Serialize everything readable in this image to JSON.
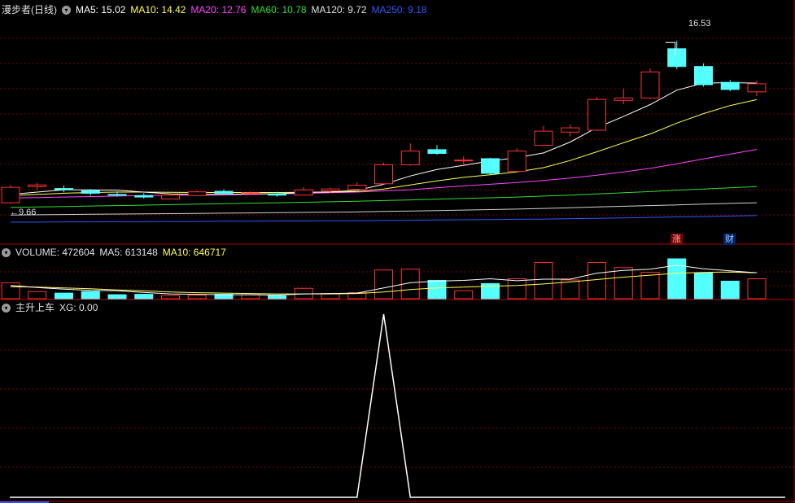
{
  "price_header": {
    "title": "漫步者(日线)",
    "ma": [
      {
        "label": "MA5: 15.02",
        "color": "#ffffff"
      },
      {
        "label": "MA10: 14.42",
        "color": "#ffff55"
      },
      {
        "label": "MA20: 12.76",
        "color": "#ff44ff"
      },
      {
        "label": "MA60: 10.78",
        "color": "#33dd33"
      },
      {
        "label": "MA120: 9.72",
        "color": "#e0e0e0"
      },
      {
        "label": "MA250: 9.18",
        "color": "#3355ff"
      }
    ]
  },
  "volume_header": {
    "items": [
      {
        "label": "VOLUME: 472604",
        "color": "#e0e0e0"
      },
      {
        "label": "MA5: 613148",
        "color": "#e0e0e0"
      },
      {
        "label": "MA10: 646717",
        "color": "#ffff55"
      }
    ]
  },
  "indicator_header": {
    "items": [
      {
        "label": "主升上车",
        "color": "#e0e0e0"
      },
      {
        "label": "XG: 0.00",
        "color": "#e0e0e0"
      }
    ]
  },
  "annotations": {
    "high_label": "16.53",
    "low_label": "←9.66",
    "badge_rise": "涨",
    "badge_finance": "财"
  },
  "colors": {
    "up": "#ff3232",
    "down": "#54ffff",
    "grid": "#7a0000",
    "border": "#b00000",
    "xg_line": "#ffffff"
  },
  "chart_data": [
    {
      "type": "candlestick",
      "title": "漫步者(日线)",
      "ylim": [
        8.5,
        17.5
      ],
      "ohlc": [
        {
          "o": 9.7,
          "h": 10.45,
          "l": 9.66,
          "c": 10.35
        },
        {
          "o": 10.38,
          "h": 10.55,
          "l": 10.25,
          "c": 10.45
        },
        {
          "o": 10.3,
          "h": 10.42,
          "l": 10.14,
          "c": 10.25
        },
        {
          "o": 10.2,
          "h": 10.28,
          "l": 10.0,
          "c": 10.1
        },
        {
          "o": 10.05,
          "h": 10.18,
          "l": 9.96,
          "c": 10.02
        },
        {
          "o": 10.0,
          "h": 10.1,
          "l": 9.88,
          "c": 9.94
        },
        {
          "o": 9.86,
          "h": 10.06,
          "l": 9.84,
          "c": 10.02
        },
        {
          "o": 10.0,
          "h": 10.22,
          "l": 9.98,
          "c": 10.16
        },
        {
          "o": 10.18,
          "h": 10.26,
          "l": 10.04,
          "c": 10.1
        },
        {
          "o": 10.1,
          "h": 10.18,
          "l": 10.02,
          "c": 10.12
        },
        {
          "o": 10.08,
          "h": 10.16,
          "l": 9.96,
          "c": 10.02
        },
        {
          "o": 10.02,
          "h": 10.36,
          "l": 10.0,
          "c": 10.24
        },
        {
          "o": 10.2,
          "h": 10.34,
          "l": 10.1,
          "c": 10.28
        },
        {
          "o": 10.26,
          "h": 10.56,
          "l": 10.22,
          "c": 10.44
        },
        {
          "o": 10.5,
          "h": 11.4,
          "l": 10.48,
          "c": 11.3
        },
        {
          "o": 11.3,
          "h": 12.2,
          "l": 11.26,
          "c": 11.88
        },
        {
          "o": 11.94,
          "h": 12.14,
          "l": 11.72,
          "c": 11.78
        },
        {
          "o": 11.5,
          "h": 11.66,
          "l": 11.32,
          "c": 11.5
        },
        {
          "o": 11.56,
          "h": 11.6,
          "l": 10.88,
          "c": 10.94
        },
        {
          "o": 11.02,
          "h": 12.0,
          "l": 10.98,
          "c": 11.88
        },
        {
          "o": 12.12,
          "h": 12.95,
          "l": 12.08,
          "c": 12.72
        },
        {
          "o": 12.68,
          "h": 13.0,
          "l": 12.5,
          "c": 12.86
        },
        {
          "o": 12.76,
          "h": 14.16,
          "l": 12.72,
          "c": 14.06
        },
        {
          "o": 14.02,
          "h": 14.5,
          "l": 13.86,
          "c": 14.12
        },
        {
          "o": 14.12,
          "h": 15.36,
          "l": 14.08,
          "c": 15.22
        },
        {
          "o": 16.2,
          "h": 16.53,
          "l": 15.34,
          "c": 15.45
        },
        {
          "o": 15.45,
          "h": 15.58,
          "l": 14.6,
          "c": 14.68
        },
        {
          "o": 14.78,
          "h": 14.88,
          "l": 14.4,
          "c": 14.48
        },
        {
          "o": 14.38,
          "h": 14.86,
          "l": 14.2,
          "c": 14.72
        }
      ],
      "ma5": [
        10.05,
        10.15,
        10.24,
        10.24,
        10.23,
        10.15,
        10.07,
        10.05,
        10.05,
        10.07,
        10.08,
        10.13,
        10.16,
        10.22,
        10.48,
        10.83,
        11.1,
        11.28,
        11.46,
        11.6,
        11.8,
        12.26,
        12.87,
        13.34,
        13.84,
        14.45,
        14.75,
        14.77,
        14.75
      ],
      "ma10": [
        10.0,
        10.05,
        10.1,
        10.13,
        10.15,
        10.15,
        10.14,
        10.13,
        10.13,
        10.13,
        10.13,
        10.14,
        10.15,
        10.17,
        10.28,
        10.45,
        10.62,
        10.77,
        10.88,
        11.0,
        11.18,
        11.48,
        11.85,
        12.23,
        12.6,
        13.06,
        13.46,
        13.8,
        14.05
      ],
      "ma20": [
        9.9,
        9.92,
        9.94,
        9.96,
        9.98,
        10.0,
        10.01,
        10.02,
        10.03,
        10.05,
        10.07,
        10.09,
        10.12,
        10.15,
        10.2,
        10.25,
        10.33,
        10.41,
        10.48,
        10.55,
        10.64,
        10.74,
        10.86,
        11.0,
        11.15,
        11.34,
        11.55,
        11.75,
        11.95
      ],
      "ma60": [
        9.5,
        9.52,
        9.54,
        9.56,
        9.58,
        9.6,
        9.62,
        9.64,
        9.66,
        9.68,
        9.7,
        9.72,
        9.74,
        9.76,
        9.79,
        9.82,
        9.85,
        9.88,
        9.91,
        9.94,
        9.98,
        10.02,
        10.07,
        10.12,
        10.17,
        10.23,
        10.28,
        10.33,
        10.38
      ],
      "ma120": [
        9.18,
        9.19,
        9.2,
        9.21,
        9.22,
        9.23,
        9.24,
        9.25,
        9.26,
        9.27,
        9.28,
        9.29,
        9.3,
        9.31,
        9.33,
        9.35,
        9.37,
        9.39,
        9.41,
        9.43,
        9.46,
        9.49,
        9.52,
        9.55,
        9.58,
        9.61,
        9.64,
        9.67,
        9.7
      ],
      "ma250": [
        8.88,
        8.88,
        8.89,
        8.89,
        8.9,
        8.9,
        8.91,
        8.91,
        8.92,
        8.92,
        8.93,
        8.93,
        8.94,
        8.94,
        8.95,
        8.96,
        8.97,
        8.98,
        8.99,
        9.0,
        9.01,
        9.03,
        9.04,
        9.06,
        9.08,
        9.1,
        9.12,
        9.14,
        9.16
      ]
    },
    {
      "type": "bar",
      "title": "VOLUME",
      "ylim": [
        0,
        1000000
      ],
      "volume": [
        400000,
        180000,
        140000,
        180000,
        100000,
        110000,
        80000,
        90000,
        110000,
        100000,
        70000,
        260000,
        130000,
        150000,
        720000,
        740000,
        460000,
        200000,
        380000,
        500000,
        910000,
        470000,
        910000,
        780000,
        660000,
        1000000,
        650000,
        440000,
        500000
      ],
      "ma5": [
        330000,
        280000,
        240000,
        210000,
        200000,
        160000,
        120000,
        110000,
        100000,
        100000,
        90000,
        120000,
        130000,
        140000,
        270000,
        400000,
        440000,
        460000,
        500000,
        450000,
        490000,
        490000,
        640000,
        710000,
        740000,
        840000,
        750000,
        700000,
        650000
      ],
      "ma10": [
        300000,
        290000,
        270000,
        250000,
        220000,
        200000,
        170000,
        150000,
        140000,
        130000,
        120000,
        120000,
        120000,
        130000,
        170000,
        230000,
        270000,
        290000,
        310000,
        330000,
        370000,
        420000,
        480000,
        540000,
        590000,
        640000,
        660000,
        670000,
        650000
      ]
    },
    {
      "type": "line",
      "title": "主升上车",
      "ylim": [
        0,
        1
      ],
      "xg": [
        0,
        0,
        0,
        0,
        0,
        0,
        0,
        0,
        0,
        0,
        0,
        0,
        0,
        0,
        1,
        0,
        0,
        0,
        0,
        0,
        0,
        0,
        0,
        0,
        0,
        0,
        0,
        0,
        0
      ]
    }
  ]
}
